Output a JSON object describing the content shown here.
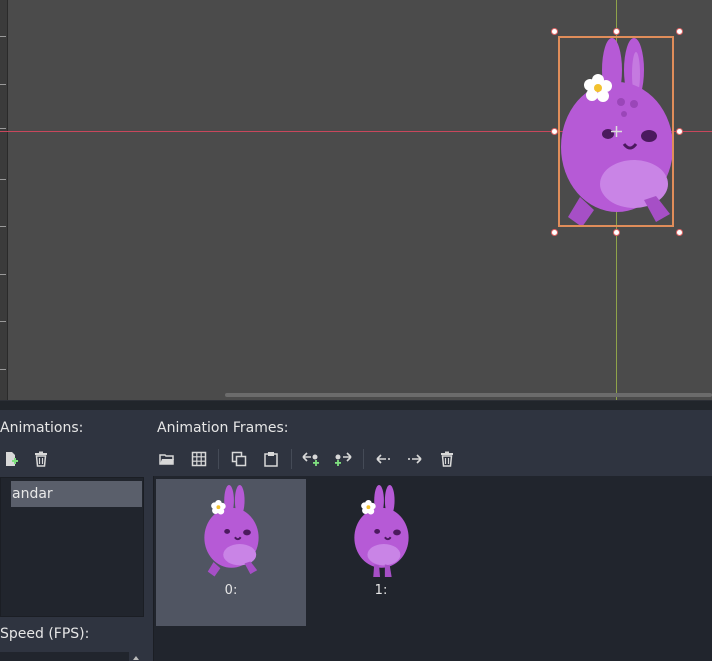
{
  "viewport": {
    "axis_colors": {
      "x_axis": "#c8475c",
      "y_axis": "#8fa34a"
    },
    "selection_color": "#e08d5a",
    "sprite_icon": "purple-bunny-sprite",
    "pivot_icon": "pivot-cross-icon"
  },
  "panel": {
    "animations_label": "Animations:",
    "animation_frames_label": "Animation Frames:",
    "speed_label": "Speed (FPS):",
    "animations_toolbar": [
      {
        "name": "new-animation-button",
        "icon": "new-file-icon"
      },
      {
        "name": "remove-animation-button",
        "icon": "trash-icon"
      }
    ],
    "animations": [
      "andar"
    ],
    "frames_toolbar": [
      {
        "name": "load-frames-button",
        "icon": "folder-open-icon"
      },
      {
        "name": "load-spritesheet-button",
        "icon": "grid-icon"
      },
      {
        "name": "copy-frame-button",
        "icon": "copy-icon"
      },
      {
        "name": "paste-frame-button",
        "icon": "paste-icon"
      },
      {
        "name": "insert-empty-before-button",
        "icon": "insert-before-icon"
      },
      {
        "name": "insert-empty-after-button",
        "icon": "insert-after-icon"
      },
      {
        "name": "move-frame-left-button",
        "icon": "arrow-left-icon"
      },
      {
        "name": "move-frame-right-button",
        "icon": "arrow-right-icon"
      },
      {
        "name": "delete-frame-button",
        "icon": "trash-icon"
      }
    ],
    "frames": [
      {
        "label": "0:",
        "selected": true
      },
      {
        "label": "1:",
        "selected": false
      }
    ]
  }
}
